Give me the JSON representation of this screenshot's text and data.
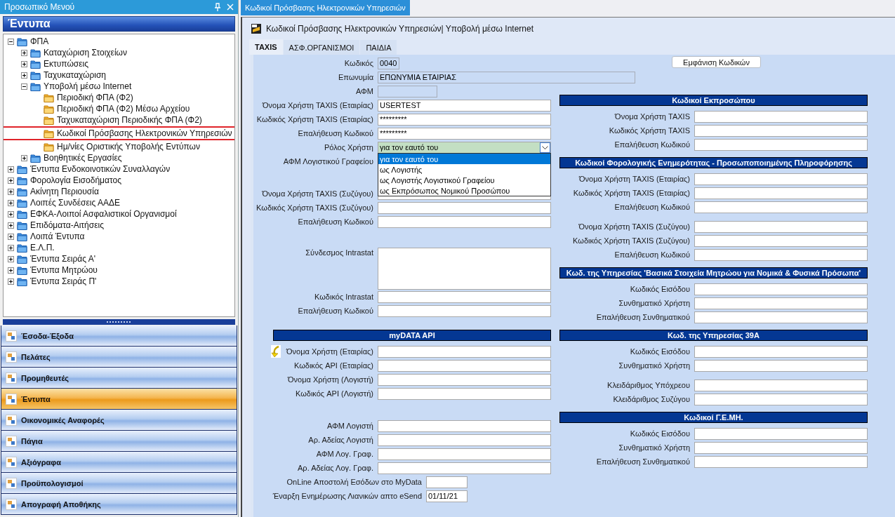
{
  "menu_panel": {
    "title": "Προσωπικό Μενού",
    "section_title": "Έντυπα",
    "tree": [
      {
        "label": "ΦΠΑ",
        "kind": "group",
        "expanded": true,
        "children": [
          {
            "label": "Καταχώριση Στοιχείων",
            "kind": "group",
            "expanded": false
          },
          {
            "label": "Εκτυπώσεις",
            "kind": "group",
            "expanded": false
          },
          {
            "label": "Ταχυκαταχώριση",
            "kind": "group",
            "expanded": false
          },
          {
            "label": "Υποβολή μέσω Internet",
            "kind": "group",
            "expanded": true,
            "children": [
              {
                "label": "Περιοδική ΦΠΑ (Φ2)",
                "kind": "form",
                "highlighted": false
              },
              {
                "label": "Περιοδική ΦΠΑ (Φ2) Μέσω Αρχείου",
                "kind": "form",
                "highlighted": false
              },
              {
                "label": "Ταχυκαταχώριση Περιοδικής ΦΠΑ (Φ2)",
                "kind": "form",
                "highlighted": false
              },
              {
                "label": "Κωδικοί Πρόσβασης Ηλεκτρονικών Υπηρεσιών",
                "kind": "form",
                "highlighted": true
              },
              {
                "label": "Ημ/νίες Οριστικής Υποβολής Εντύπων",
                "kind": "form",
                "highlighted": false
              }
            ]
          },
          {
            "label": "Βοηθητικές Εργασίες",
            "kind": "group",
            "expanded": false
          }
        ]
      },
      {
        "label": "Έντυπα Ενδοκοινοτικών Συναλλαγών",
        "kind": "group",
        "expanded": false
      },
      {
        "label": "Φορολογία  Εισοδήματος",
        "kind": "group",
        "expanded": false
      },
      {
        "label": "Ακίνητη Περιουσία",
        "kind": "group",
        "expanded": false
      },
      {
        "label": "Λοιπές Συνδέσεις ΑΑΔΕ",
        "kind": "group",
        "expanded": false
      },
      {
        "label": "ΕΦΚΑ-Λοιποί Ασφαλιστικοί Οργανισμοί",
        "kind": "group",
        "expanded": false
      },
      {
        "label": "Επιδόματα-Αιτήσεις",
        "kind": "group",
        "expanded": false
      },
      {
        "label": "Λοιπά Έντυπα",
        "kind": "group",
        "expanded": false
      },
      {
        "label": "Ε.Λ.Π.",
        "kind": "group",
        "expanded": false
      },
      {
        "label": "Έντυπα Σειράς Α'",
        "kind": "group",
        "expanded": false
      },
      {
        "label": "Έντυπα Μητρώου",
        "kind": "group",
        "expanded": false
      },
      {
        "label": "Έντυπα Σειράς Π'",
        "kind": "group",
        "expanded": false
      }
    ],
    "nav": [
      {
        "label": "Έσοδα-Έξοδα",
        "selected": false
      },
      {
        "label": "Πελάτες",
        "selected": false
      },
      {
        "label": "Προμηθευτές",
        "selected": false
      },
      {
        "label": "Έντυπα",
        "selected": true
      },
      {
        "label": "Οικονομικές Αναφορές",
        "selected": false
      },
      {
        "label": "Πάγια",
        "selected": false
      },
      {
        "label": "Αξιόγραφα",
        "selected": false
      },
      {
        "label": "Προϋπολογισμοί",
        "selected": false
      },
      {
        "label": "Απογραφή Αποθήκης",
        "selected": false
      }
    ]
  },
  "document_tab": {
    "title": "Κωδικοί Πρόσβασης Ηλεκτρονικών Υπηρεσιών"
  },
  "window": {
    "title": "Κωδικοί Πρόσβασης Ηλεκτρονικών Υπηρεσιών| Υποβολή μέσω Internet",
    "tabs": [
      {
        "label": "TAXIS",
        "selected": true
      },
      {
        "label": "ΑΣΦ.ΟΡΓΑΝΙΣΜΟΙ",
        "selected": false
      },
      {
        "label": "ΠΑΙΔΙΑ",
        "selected": false
      }
    ],
    "show_codes_button": "Εμφάνιση Κωδικών",
    "left_sections": [
      {
        "groups": [
          [
            {
              "label": "Κωδικός",
              "kind": "readonly",
              "value": "0040"
            },
            {
              "label": "Επωνυμία",
              "kind": "readonly",
              "value": "ΕΠΩΝΥΜΙΑ ΕΤΑΙΡΙΑΣ"
            },
            {
              "label": "ΑΦΜ",
              "kind": "readonly"
            },
            {
              "label": "Όνομα Χρήστη TAXIS (Εταιρίας)",
              "kind": "text",
              "value": "USERTEST"
            },
            {
              "label": "Κωδικός Χρήστη TAXIS (Εταιρίας)",
              "kind": "text",
              "value": "*********"
            },
            {
              "label": "Επαλήθευση Κωδικού",
              "kind": "text",
              "value": "*********"
            },
            {
              "label": "Ρόλος Χρήστη",
              "kind": "select",
              "value": "για τον εαυτό του",
              "open": true,
              "options": [
                {
                  "label": "για τον εαυτό του",
                  "selected": true
                },
                {
                  "label": "ως Λογιστής",
                  "selected": false
                },
                {
                  "label": "ως Λογιστής Λογιστικού Γραφείου",
                  "selected": false
                },
                {
                  "label": "ως Εκπρόσωπος Νομικού Προσώπου",
                  "selected": false
                }
              ]
            },
            {
              "label": "ΑΦΜ Λογιστικού Γραφείου",
              "kind": "text"
            }
          ],
          [
            {
              "label": "Όνομα Χρήστη TAXIS (Συζύγου)",
              "kind": "text"
            },
            {
              "label": "Κωδικός Χρήστη TAXIS (Συζύγου)",
              "kind": "text"
            },
            {
              "label": "Επαλήθευση Κωδικού",
              "kind": "text"
            }
          ],
          [
            {
              "label": "Σύνδεσμος Intrastat",
              "kind": "textarea"
            },
            {
              "label": "Κωδικός Intrastat",
              "kind": "text"
            },
            {
              "label": "Επαλήθευση Κωδικού",
              "kind": "text"
            }
          ]
        ]
      },
      {
        "title": "myDATA API",
        "groups": [
          [
            {
              "label": "Όνομα Χρήστη (Εταιρίας)",
              "kind": "text",
              "arrow": true
            },
            {
              "label": "Κωδικός API (Εταιρίας)",
              "kind": "text"
            },
            {
              "label": "Όνομα Χρήστη (Λογιστή)",
              "kind": "text"
            },
            {
              "label": "Κωδικός API (Λογιστή)",
              "kind": "text"
            }
          ],
          [
            {
              "label": "ΑΦΜ Λογιστή",
              "kind": "text"
            },
            {
              "label": "Αρ. Αδείας Λογιστή",
              "kind": "text"
            },
            {
              "label": "ΑΦΜ Λογ. Γραφ.",
              "kind": "text"
            },
            {
              "label": "Αρ. Αδείας Λογ. Γραφ.",
              "kind": "text"
            },
            {
              "label": "OnLine Αποστολή Εσόδων στο MyData",
              "kind": "short"
            },
            {
              "label": "Έναρξη Ενημέρωσης Λιανικών απτο eSend",
              "kind": "short",
              "value": "01/11/21"
            }
          ]
        ]
      }
    ],
    "right_sections": [
      {
        "title": "Κωδικοί Εκπροσώπου",
        "groups": [
          [
            {
              "label": "Όνομα Χρήστη TAXIS",
              "kind": "text"
            },
            {
              "label": "Κωδικός Χρήστη TAXIS",
              "kind": "text"
            },
            {
              "label": "Επαλήθευση Κωδικού",
              "kind": "text"
            }
          ]
        ]
      },
      {
        "title": "Κωδικοί Φορολογικής Ενημερότητας - Προσωποποιημένης Πληροφόρησης",
        "groups": [
          [
            {
              "label": "Όνομα Χρήστη TAXIS (Εταιρίας)",
              "kind": "text"
            },
            {
              "label": "Κωδικός Χρήστη TAXIS (Εταιρίας)",
              "kind": "text"
            },
            {
              "label": "Επαλήθευση Κωδικού",
              "kind": "text"
            }
          ],
          [
            {
              "label": "Όνομα Χρήστη TAXIS (Συζύγου)",
              "kind": "text"
            },
            {
              "label": "Κωδικός Χρήστη TAXIS (Συζύγου)",
              "kind": "text"
            },
            {
              "label": "Επαλήθευση Κωδικού",
              "kind": "text"
            }
          ]
        ]
      },
      {
        "title": "Κωδ. της Υπηρεσίας 'Βασικά Στοιχεία Μητρώου για Νομικά & Φυσικά Πρόσωπα'",
        "groups": [
          [
            {
              "label": "Κωδικός Εισόδου",
              "kind": "text"
            },
            {
              "label": "Συνθηματικό Χρήστη",
              "kind": "text"
            },
            {
              "label": "Επαλήθευση Συνθηματικού",
              "kind": "text"
            }
          ]
        ]
      },
      {
        "title": "Κωδ. της Υπηρεσίας 39Α",
        "groups": [
          [
            {
              "label": "Κωδικός Εισόδου",
              "kind": "text"
            },
            {
              "label": "Συνθηματικό Χρήστη",
              "kind": "text"
            }
          ],
          [
            {
              "label": "Κλειδάριθμος Υπόχρεου",
              "kind": "text"
            },
            {
              "label": "Κλειδάριθμος Συζύγου",
              "kind": "text"
            }
          ]
        ]
      },
      {
        "title": "Κωδικοί Γ.Ε.ΜΗ.",
        "groups": [
          [
            {
              "label": "Κωδικός Εισόδου",
              "kind": "text"
            },
            {
              "label": "Συνθηματικό Χρήστη",
              "kind": "text"
            },
            {
              "label": "Επαλήθευση Συνθηματικού",
              "kind": "text"
            }
          ]
        ]
      }
    ]
  }
}
